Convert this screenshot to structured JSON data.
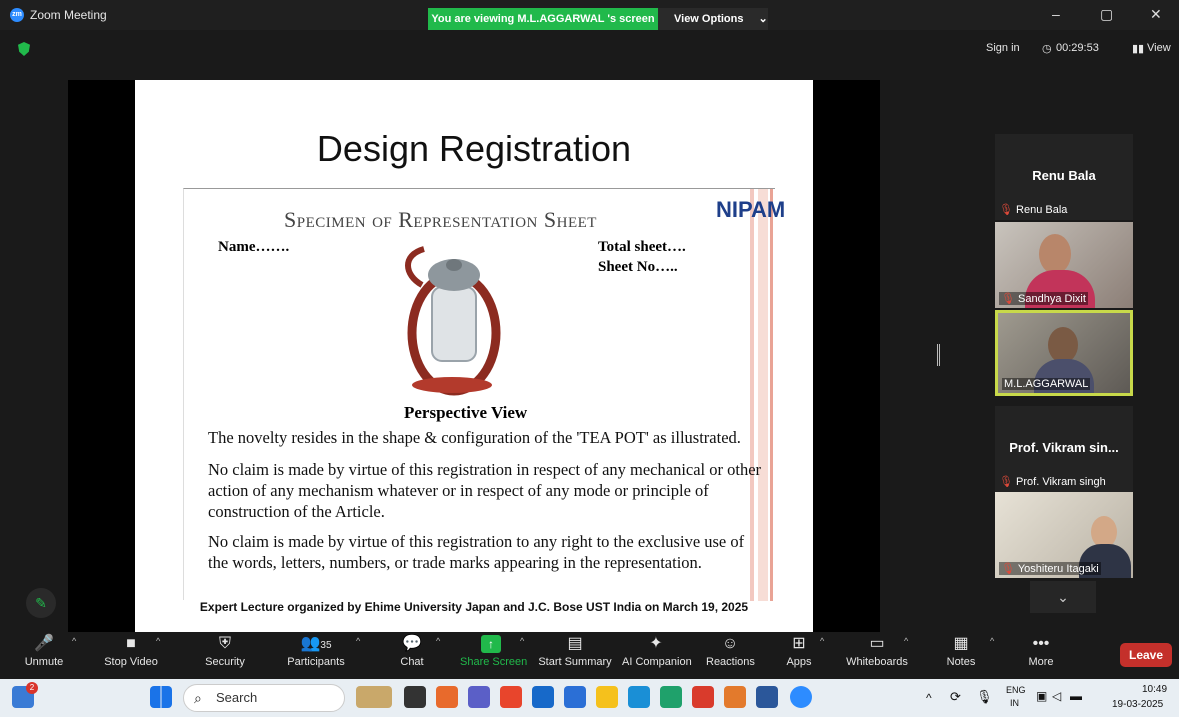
{
  "titlebar": {
    "app_title": "Zoom Meeting",
    "logo_text": "zm",
    "viewing_banner": "You are viewing M.L.AGGARWAL 's screen",
    "view_options": "View Options",
    "view_options_caret": "⌄",
    "minimize": "–",
    "maximize": "▢",
    "close": "✕"
  },
  "topright": {
    "sign_in": "Sign in",
    "timer": "00:29:53",
    "view": "View"
  },
  "slide": {
    "title": "Design Registration",
    "sheet_header": "Specimen of Representation Sheet",
    "logo": "NIPAM",
    "name_label": "Name…….",
    "total_sheet": "Total sheet….",
    "sheet_no": "Sheet No…..",
    "caption": "Perspective View",
    "para1": "The novelty resides in the shape & configuration of the 'TEA POT' as illustrated.",
    "para2": "No claim is made by virtue of this registration in respect of any mechanical or other action of any mechanism whatever or in respect of any mode or principle of construction of the Article.",
    "para3": "No claim is made by virtue of this registration to any right to the exclusive use of the words, letters, numbers, or trade marks appearing in the representation.",
    "footer": "Expert Lecture organized by Ehime University Japan and J.C. Bose UST India on March 19, 2025"
  },
  "participants_panel": {
    "tile1_bigname": "Renu Bala",
    "tile1_tag": "Renu Bala",
    "tile2_tag": "Sandhya Dixit",
    "tile3_tag": "M.L.AGGARWAL",
    "tile4_bigname": "Prof. Vikram sin...",
    "tile4_tag": "Prof. Vikram singh",
    "tile5_tag": "Yoshiteru Itagaki",
    "scroll_down": "⌄"
  },
  "toolbar": {
    "items": [
      {
        "label": "Unmute",
        "icon": "🎤"
      },
      {
        "label": "Stop Video",
        "icon": "■"
      },
      {
        "label": "Security",
        "icon": "⛨"
      },
      {
        "label": "Participants",
        "icon": "👥",
        "count": "35"
      },
      {
        "label": "Chat",
        "icon": "💬"
      },
      {
        "label": "Share Screen",
        "icon": "↑"
      },
      {
        "label": "Start Summary",
        "icon": "▤"
      },
      {
        "label": "AI Companion",
        "icon": "✦"
      },
      {
        "label": "Reactions",
        "icon": "☺"
      },
      {
        "label": "Apps",
        "icon": "⊞"
      },
      {
        "label": "Whiteboards",
        "icon": "▭"
      },
      {
        "label": "Notes",
        "icon": "▦"
      },
      {
        "label": "More",
        "icon": "•••"
      }
    ],
    "leave": "Leave",
    "share_color": "#21b94b"
  },
  "taskbar": {
    "search_placeholder": "Search",
    "badge": "2",
    "lang_top": "ENG",
    "lang_bottom": "IN",
    "time": "10:49",
    "date": "19-03-2025",
    "tray_caret": "^"
  }
}
